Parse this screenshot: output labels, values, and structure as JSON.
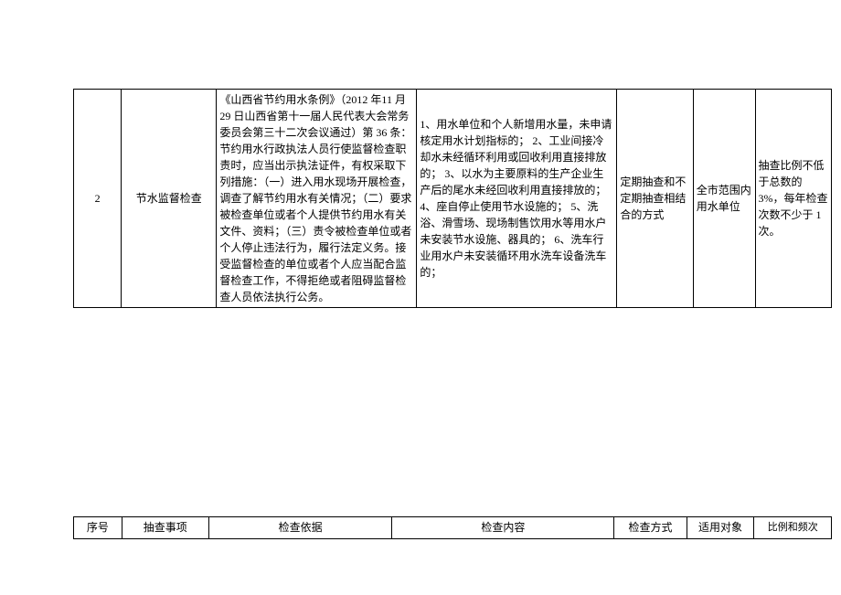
{
  "main_row": {
    "num": "2",
    "item": "节水监督检查",
    "basis": "《山西省节约用水条例》（2012 年11 月 29 日山西省第十一届人民代表大会常务委员会第三十二次会议通过）第 36 条：节约用水行政执法人员行使监督检查职责时，应当出示执法证件，有权采取下列措施：（一）进入用水现场开展检查，调查了解节约用水有关情况；（二）要求被检查单位或者个人提供节约用水有关文件、资料；（三）责令被检查单位或者个人停止违法行为，履行法定义务。接受监督检查的单位或者个人应当配合监督检查工作，不得拒绝或者阻碍监督检查人员依法执行公务。",
    "content": "1、用水单位和个人新增用水量，未申请核定用水计划指标的；\n2、工业间接冷却水未经循环利用或回收利用直接排放的；\n3、以水为主要原料的生产企业生产后的尾水未经回收利用直接排放的；\n4、座自停止使用节水设施的；\n5、洗浴、滑雪场、现场制售饮用水等用水户未安装节水设施、器具的；\n6、洗车行业用水户未安装循环用水洗车设备洗车的；",
    "method": "定期抽查和不定期抽查相结合的方式",
    "target": "全市范围内用水单位",
    "ratio": "抽查比例不低于总数的 3%，每年检查次数不少于 1 次。"
  },
  "header": {
    "num": "序号",
    "item": "抽查事项",
    "basis": "检查依据",
    "content": "检查内容",
    "method": "检查方式",
    "target": "适用对象",
    "ratio": "比例和频次"
  }
}
